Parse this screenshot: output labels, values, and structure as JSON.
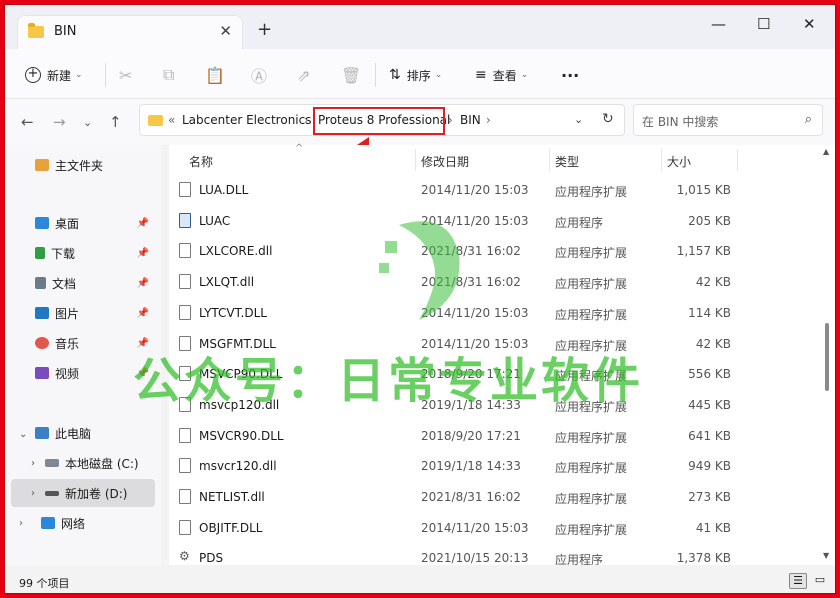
{
  "window": {
    "tab_title": "BIN",
    "tab_close": "✕",
    "new_tab": "+",
    "minimize": "—",
    "maximize": "☐",
    "close": "✕"
  },
  "toolbar": {
    "new_label": "新建",
    "sort_label": "排序",
    "view_label": "查看",
    "more": "···"
  },
  "address": {
    "overflow": "«",
    "crumbs": [
      "Labcenter Electronics",
      "Proteus 8 Professional",
      "BIN"
    ],
    "search_placeholder": "在 BIN 中搜索"
  },
  "sidebar": {
    "home": "主文件夹",
    "quick_access": [
      {
        "label": "桌面",
        "color": "#2b88d8"
      },
      {
        "label": "下载",
        "color": "#2f9e44"
      },
      {
        "label": "文档",
        "color": "#6b7b8c"
      },
      {
        "label": "图片",
        "color": "#1f78c1"
      },
      {
        "label": "音乐",
        "color": "#e2574c"
      },
      {
        "label": "视频",
        "color": "#7b4bbd"
      }
    ],
    "this_pc": "此电脑",
    "drives": [
      "本地磁盘 (C:)",
      "新加卷 (D:)"
    ],
    "network": "网络"
  },
  "columns": {
    "name": "名称",
    "date": "修改日期",
    "type": "类型",
    "size": "大小"
  },
  "files": [
    {
      "name": "LUA.DLL",
      "date": "2014/11/20 15:03",
      "type": "应用程序扩展",
      "size": "1,015 KB",
      "icon": "dll"
    },
    {
      "name": "LUAC",
      "date": "2014/11/20 15:03",
      "type": "应用程序",
      "size": "205 KB",
      "icon": "exe"
    },
    {
      "name": "LXLCORE.dll",
      "date": "2021/8/31 16:02",
      "type": "应用程序扩展",
      "size": "1,157 KB",
      "icon": "dll"
    },
    {
      "name": "LXLQT.dll",
      "date": "2021/8/31 16:02",
      "type": "应用程序扩展",
      "size": "42 KB",
      "icon": "dll"
    },
    {
      "name": "LYTCVT.DLL",
      "date": "2014/11/20 15:03",
      "type": "应用程序扩展",
      "size": "114 KB",
      "icon": "dll"
    },
    {
      "name": "MSGFMT.DLL",
      "date": "2014/11/20 15:03",
      "type": "应用程序扩展",
      "size": "42 KB",
      "icon": "dll"
    },
    {
      "name": "MSVCP90.DLL",
      "date": "2018/9/20 17:21",
      "type": "应用程序扩展",
      "size": "556 KB",
      "icon": "dll"
    },
    {
      "name": "msvcp120.dll",
      "date": "2019/1/18 14:33",
      "type": "应用程序扩展",
      "size": "445 KB",
      "icon": "dll"
    },
    {
      "name": "MSVCR90.DLL",
      "date": "2018/9/20 17:21",
      "type": "应用程序扩展",
      "size": "641 KB",
      "icon": "dll"
    },
    {
      "name": "msvcr120.dll",
      "date": "2019/1/18 14:33",
      "type": "应用程序扩展",
      "size": "949 KB",
      "icon": "dll"
    },
    {
      "name": "NETLIST.dll",
      "date": "2021/8/31 16:02",
      "type": "应用程序扩展",
      "size": "273 KB",
      "icon": "dll"
    },
    {
      "name": "OBJITF.DLL",
      "date": "2014/11/20 15:03",
      "type": "应用程序扩展",
      "size": "41 KB",
      "icon": "dll"
    },
    {
      "name": "PDS",
      "date": "2021/10/15 20:13",
      "type": "应用程序",
      "size": "1,378 KB",
      "icon": "gear"
    }
  ],
  "status": {
    "item_count": "99 个项目"
  },
  "watermark": "公众号：日常专业软件"
}
